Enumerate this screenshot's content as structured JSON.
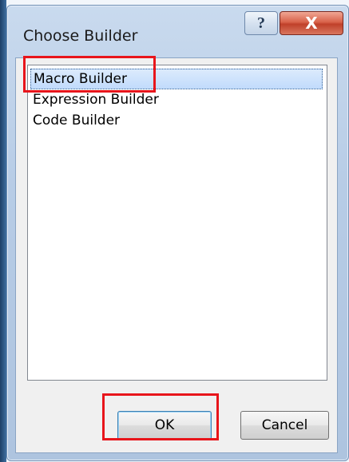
{
  "window": {
    "title": "Choose Builder",
    "help_label": "?",
    "close_label": "X"
  },
  "list": {
    "items": [
      {
        "label": "Macro Builder",
        "selected": true
      },
      {
        "label": "Expression Builder",
        "selected": false
      },
      {
        "label": "Code Builder",
        "selected": false
      }
    ]
  },
  "buttons": {
    "ok_label": "OK",
    "cancel_label": "Cancel"
  },
  "annotations": {
    "highlight_color": "#e8151b"
  }
}
